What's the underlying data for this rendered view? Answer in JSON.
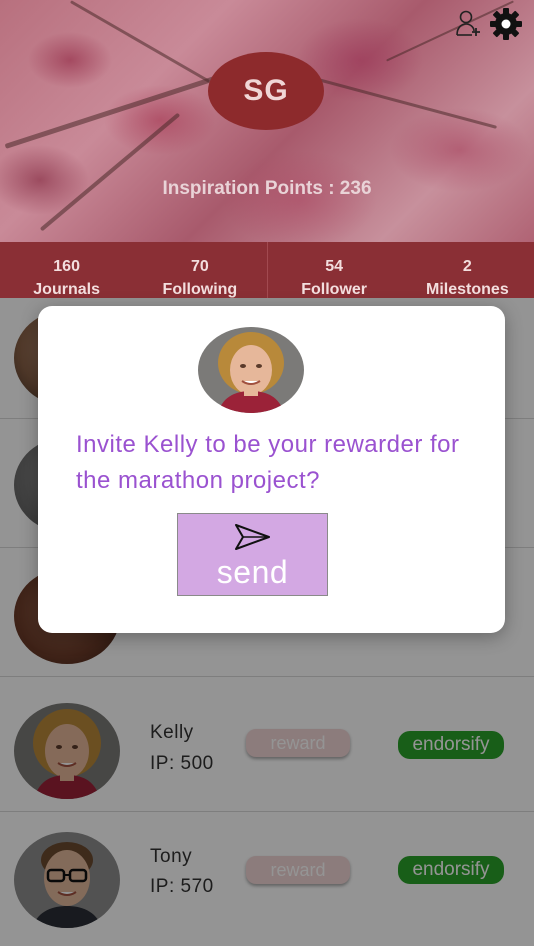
{
  "header": {
    "initials": "SG",
    "inspiration_points_label": "Inspiration Points : 236",
    "icons": {
      "add_user": "add-user-icon",
      "settings": "gear-icon"
    }
  },
  "stats": [
    {
      "value": "160",
      "label": "Journals"
    },
    {
      "value": "70",
      "label": "Following"
    },
    {
      "value": "54",
      "label": "Follower"
    },
    {
      "value": "2",
      "label": "Milestones"
    }
  ],
  "list": [
    {
      "name": "Kelly",
      "ip": "IP: 500",
      "reward_label": "reward",
      "endorse_label": "endorsify"
    },
    {
      "name": "Tony",
      "ip": "IP: 570",
      "reward_label": "reward",
      "endorse_label": "endorsify"
    }
  ],
  "modal": {
    "message": "Invite Kelly to be your rewarder for the marathon project?",
    "send_label": "send"
  },
  "colors": {
    "stats_bar": "#8a2f35",
    "modal_text": "#9a52d0",
    "send_button": "#d3a8e3",
    "endorse_button": "#2aa22a"
  }
}
